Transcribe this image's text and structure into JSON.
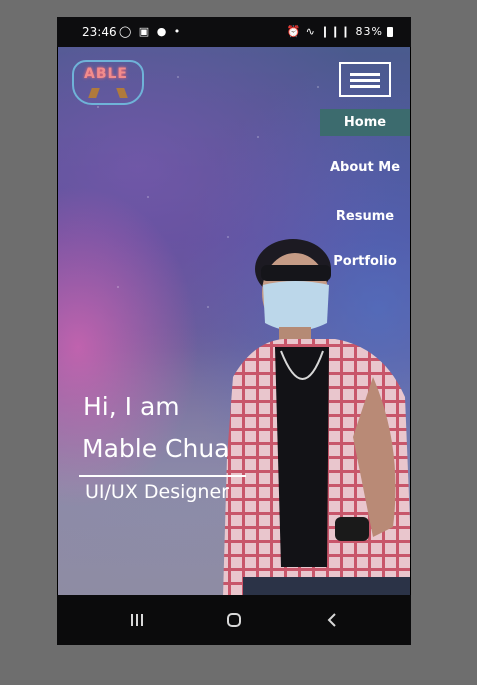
{
  "status_bar": {
    "time": "23:46",
    "left_icons": "◯ ▣ ● •",
    "right_icons": "⏰ ∿ ❙❙❙",
    "battery": "83%"
  },
  "logo": {
    "text": "ABLE"
  },
  "menu": {
    "items": [
      {
        "label": "Home",
        "active": true
      },
      {
        "label": "About Me"
      },
      {
        "label": "Resume"
      },
      {
        "label": "Portfolio"
      }
    ]
  },
  "hero": {
    "greeting": "Hi, I am",
    "name": "Mable Chua",
    "title": "UI/UX Designer"
  },
  "colors": {
    "menu_active_bg": "#3c6b6e",
    "logo_border": "#6fb3d8",
    "logo_text": "#f28c8c"
  }
}
